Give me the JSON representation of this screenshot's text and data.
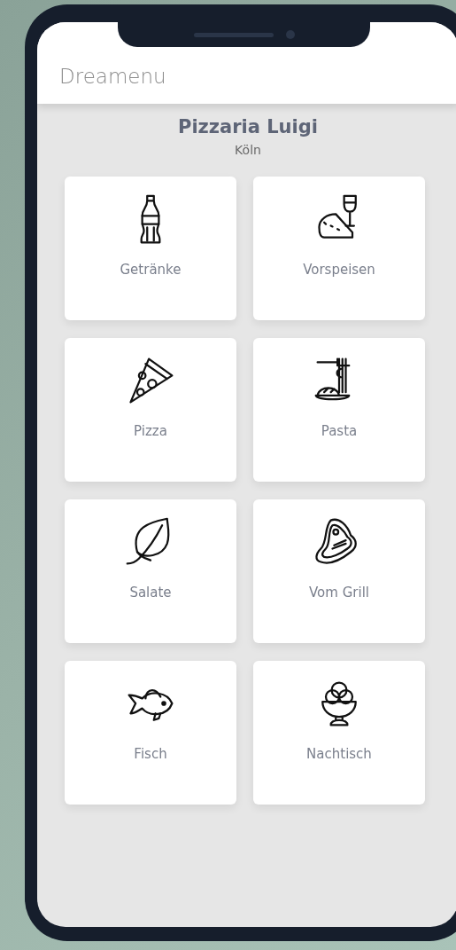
{
  "app_bar": {
    "title": "Dreamenu"
  },
  "restaurant": {
    "name": "Pizzaria Luigi",
    "city": "Köln"
  },
  "categories": [
    {
      "label": "Getränke"
    },
    {
      "label": "Vorspeisen"
    },
    {
      "label": "Pizza"
    },
    {
      "label": "Pasta"
    },
    {
      "label": "Salate"
    },
    {
      "label": "Vom Grill"
    },
    {
      "label": "Fisch"
    },
    {
      "label": "Nachtisch"
    }
  ]
}
